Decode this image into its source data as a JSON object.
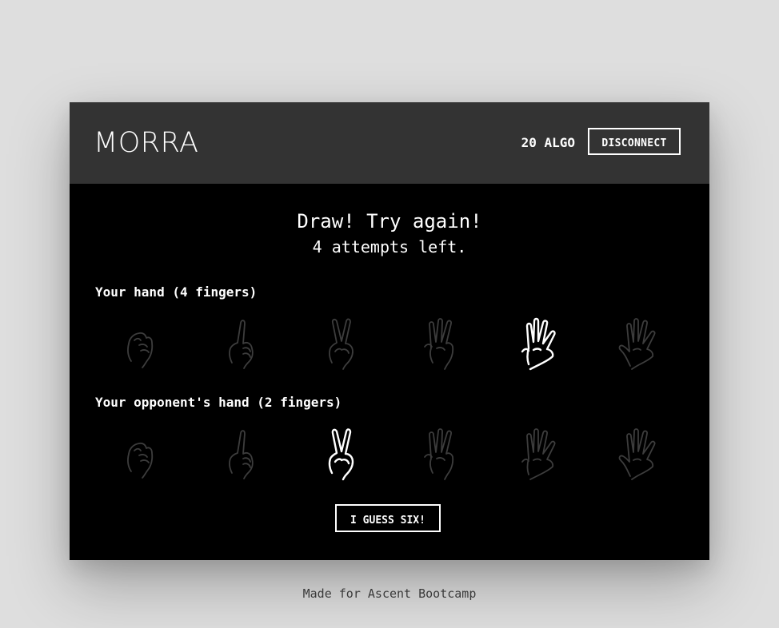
{
  "header": {
    "logo": "MORRA",
    "balance": "20 ALGO",
    "disconnect_label": "DISCONNECT"
  },
  "result": {
    "title": "Draw! Try again!",
    "subtitle": "4 attempts left."
  },
  "your_hand": {
    "label": "Your hand (4 fingers)",
    "selected_fingers": 4,
    "options": [
      0,
      1,
      2,
      3,
      4,
      5
    ]
  },
  "opponent_hand": {
    "label": "Your opponent's hand (2 fingers)",
    "selected_fingers": 2,
    "options": [
      0,
      1,
      2,
      3,
      4,
      5
    ]
  },
  "guess_button_label": "I GUESS SIX!",
  "footer": "Made for Ascent Bootcamp",
  "colors": {
    "page_background": "#dedede",
    "header_background": "#333333",
    "panel_background": "#000000",
    "selected_hand": "#ffffff",
    "unselected_hand": "#3d3d3d"
  }
}
